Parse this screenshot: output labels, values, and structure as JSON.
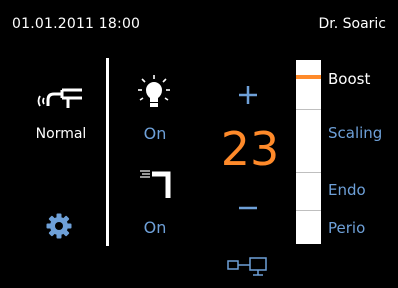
{
  "header": {
    "datetime": "01.01.2011  18:00",
    "user": "Dr. Soaric"
  },
  "mode": {
    "icon": "handpiece-mode-icon",
    "label": "Normal"
  },
  "settings": {
    "icon": "gear-icon"
  },
  "light": {
    "icon": "light-bulb-icon",
    "status": "On"
  },
  "water": {
    "icon": "water-spray-icon",
    "status": "On"
  },
  "power": {
    "plus_icon": "plus-icon",
    "value": "23",
    "minus_icon": "minus-icon",
    "handpiece_icon": "handpiece-connection-icon"
  },
  "mode_selector": {
    "options": [
      "Boost",
      "Scaling",
      "Endo",
      "Perio"
    ],
    "selected": "Boost"
  },
  "colors": {
    "background": "#000000",
    "accent_blue": "#6ea0d8",
    "accent_orange": "#ff8a2a",
    "text": "#ffffff"
  }
}
